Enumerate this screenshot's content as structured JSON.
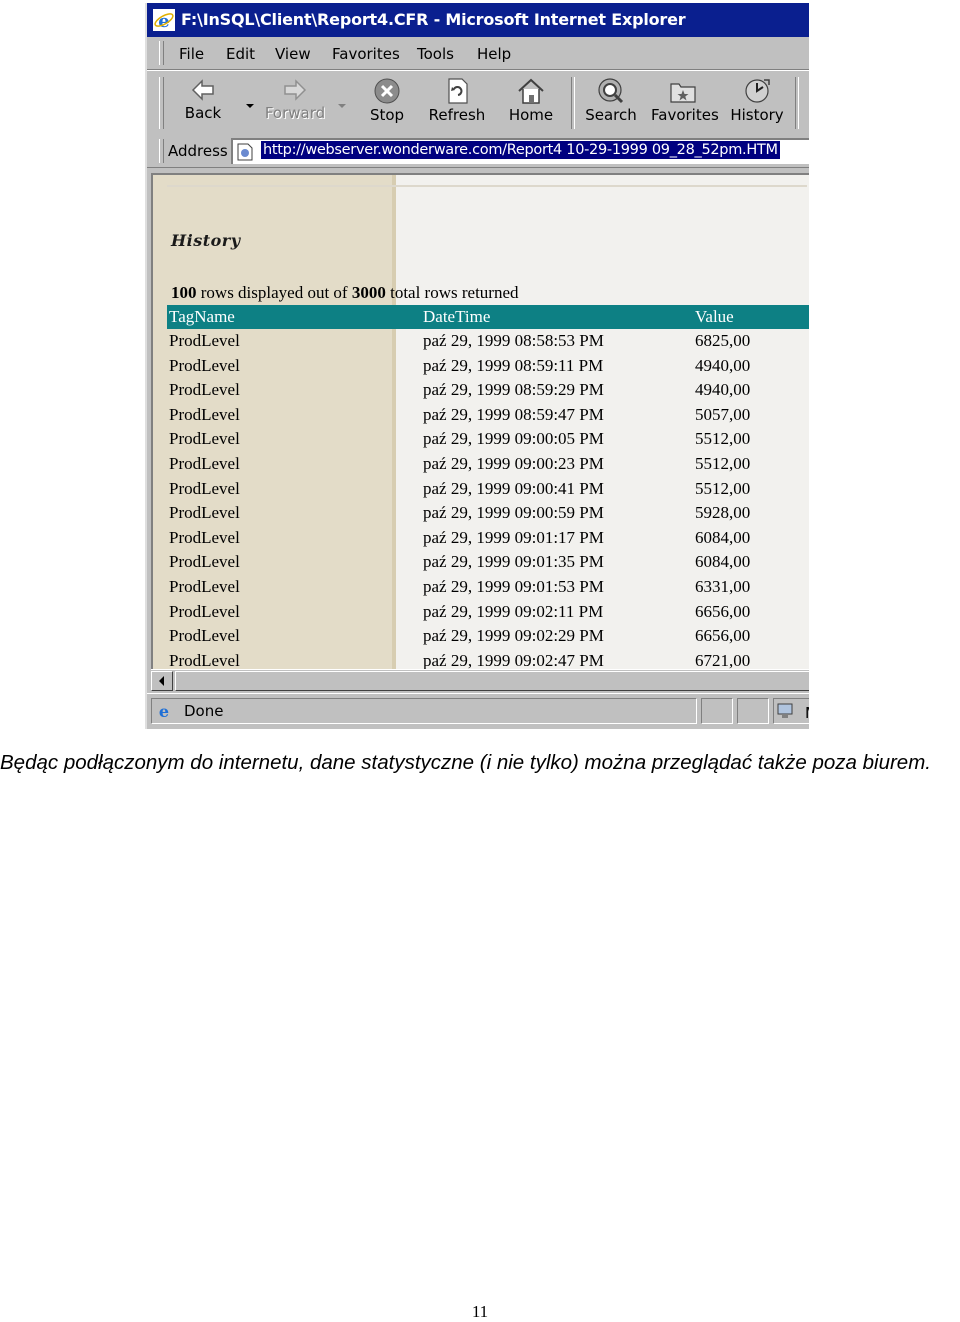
{
  "window": {
    "title": "F:\\InSQL\\Client\\Report4.CFR - Microsoft Internet Explorer"
  },
  "menu": [
    "File",
    "Edit",
    "View",
    "Favorites",
    "Tools",
    "Help"
  ],
  "toolbar": {
    "back": "Back",
    "forward": "Forward",
    "stop": "Stop",
    "refresh": "Refresh",
    "home": "Home",
    "search": "Search",
    "favorites": "Favorites",
    "history": "History"
  },
  "address": {
    "label": "Address",
    "url": "http://webserver.wonderware.com/Report4 10-29-1999 09_28_52pm.HTM"
  },
  "report": {
    "title": "History",
    "summary": {
      "displayed": "100",
      "text1": " rows displayed out of ",
      "total": "3000",
      "text2": " total rows returned"
    },
    "columns": [
      "TagName",
      "DateTime",
      "Value"
    ],
    "rows": [
      [
        "ProdLevel",
        "paź 29, 1999 08:58:53 PM",
        "6825,00"
      ],
      [
        "ProdLevel",
        "paź 29, 1999 08:59:11 PM",
        "4940,00"
      ],
      [
        "ProdLevel",
        "paź 29, 1999 08:59:29 PM",
        "4940,00"
      ],
      [
        "ProdLevel",
        "paź 29, 1999 08:59:47 PM",
        "5057,00"
      ],
      [
        "ProdLevel",
        "paź 29, 1999 09:00:05 PM",
        "5512,00"
      ],
      [
        "ProdLevel",
        "paź 29, 1999 09:00:23 PM",
        "5512,00"
      ],
      [
        "ProdLevel",
        "paź 29, 1999 09:00:41 PM",
        "5512,00"
      ],
      [
        "ProdLevel",
        "paź 29, 1999 09:00:59 PM",
        "5928,00"
      ],
      [
        "ProdLevel",
        "paź 29, 1999 09:01:17 PM",
        "6084,00"
      ],
      [
        "ProdLevel",
        "paź 29, 1999 09:01:35 PM",
        "6084,00"
      ],
      [
        "ProdLevel",
        "paź 29, 1999 09:01:53 PM",
        "6331,00"
      ],
      [
        "ProdLevel",
        "paź 29, 1999 09:02:11 PM",
        "6656,00"
      ],
      [
        "ProdLevel",
        "paź 29, 1999 09:02:29 PM",
        "6656,00"
      ],
      [
        "ProdLevel",
        "paź 29, 1999 09:02:47 PM",
        "6721,00"
      ]
    ]
  },
  "status": {
    "text": "Done",
    "zone": "M"
  },
  "caption": "Będąc podłączonym do internetu, dane statystyczne (i nie tylko) można przeglądać także poza biurem.",
  "page_number": "11",
  "colors": {
    "titlebar": "#0a1f8f",
    "table_header": "#0d8084",
    "window_chrome": "#c0c0c0",
    "url_highlight": "#000080"
  }
}
